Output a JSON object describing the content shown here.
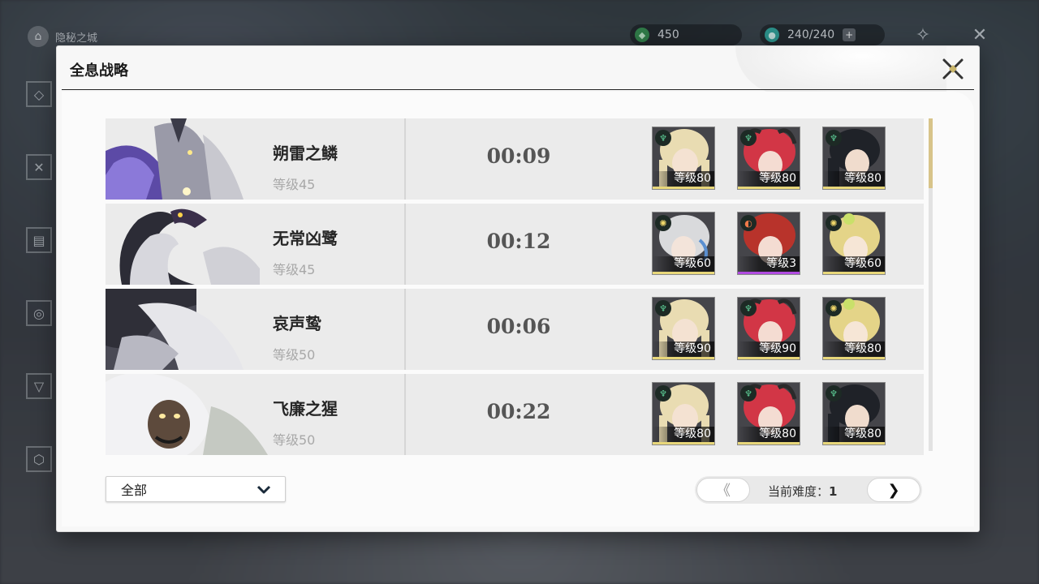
{
  "hud": {
    "location_label": "隐秘之城",
    "resource1_value": "450",
    "resource2_value": "240/240"
  },
  "modal": {
    "title": "全息战略"
  },
  "bosses": [
    {
      "name": "朔雷之鳞",
      "level": "等级45",
      "time": "00:09",
      "team": [
        {
          "level": "等级80",
          "element": "aero",
          "hair": "#e9dcb2",
          "bar": "gold"
        },
        {
          "level": "等级80",
          "element": "aero",
          "hair": "#d23646",
          "bar": "gold"
        },
        {
          "level": "等级80",
          "element": "aero",
          "hair": "#1f2228",
          "bar": "gold"
        }
      ]
    },
    {
      "name": "无常凶鹭",
      "level": "等级45",
      "time": "00:12",
      "team": [
        {
          "level": "等级60",
          "element": "spectro",
          "hair": "#d9dadc",
          "bar": "gold"
        },
        {
          "level": "等级3",
          "element": "fusion",
          "hair": "#b8332b",
          "bar": "purple"
        },
        {
          "level": "等级60",
          "element": "spectro",
          "hair": "#e4d488",
          "bar": "gold"
        }
      ]
    },
    {
      "name": "哀声鸷",
      "level": "等级50",
      "time": "00:06",
      "team": [
        {
          "level": "等级90",
          "element": "aero",
          "hair": "#e9dcb2",
          "bar": "gold"
        },
        {
          "level": "等级90",
          "element": "aero",
          "hair": "#d23646",
          "bar": "gold"
        },
        {
          "level": "等级80",
          "element": "spectro",
          "hair": "#e4d488",
          "bar": "gold"
        }
      ]
    },
    {
      "name": "飞廉之猩",
      "level": "等级50",
      "time": "00:22",
      "team": [
        {
          "level": "等级80",
          "element": "aero",
          "hair": "#e9dcb2",
          "bar": "gold"
        },
        {
          "level": "等级80",
          "element": "aero",
          "hair": "#d23646",
          "bar": "gold"
        },
        {
          "level": "等级80",
          "element": "aero",
          "hair": "#1f2228",
          "bar": "gold"
        }
      ]
    }
  ],
  "filter": {
    "selected": "全部"
  },
  "pager": {
    "difficulty_label": "当前难度：",
    "difficulty_value": "1",
    "prev_symbol": "《",
    "next_symbol": "❯"
  },
  "colors": {
    "gold_bar": "#e8d77a",
    "purple_bar": "#b04be0",
    "aero": "#5fd39a",
    "spectro": "#f0d86a",
    "fusion": "#f07a4a"
  }
}
